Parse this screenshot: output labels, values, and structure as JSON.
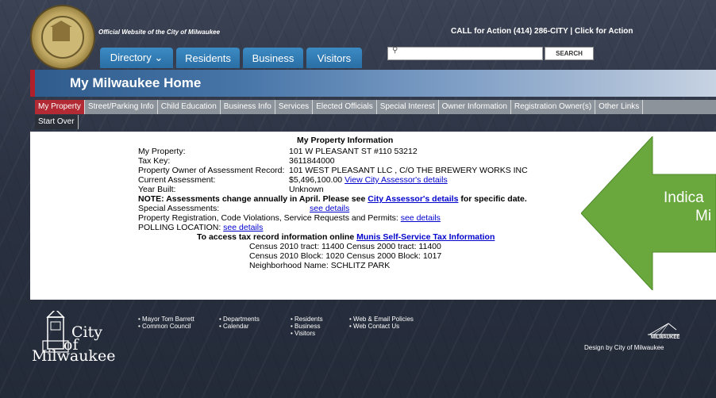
{
  "header": {
    "official_text": "Official Website of the City of Milwaukee",
    "call_action": "CALL for Action (414) 286-CITY | Click for Action",
    "nav_tabs": [
      "Directory ⌄",
      "Residents",
      "Business",
      "Visitors"
    ],
    "search_button": "SEARCH",
    "search_placeholder": ""
  },
  "page_title": "My Milwaukee Home",
  "subnav": [
    "My Property",
    "Street/Parking Info",
    "Child Education",
    "Business Info",
    "Services",
    "Elected Officials",
    "Special Interest",
    "Owner Information",
    "Registration Owner(s)",
    "Other Links"
  ],
  "start_over": "Start Over",
  "property": {
    "heading": "My Property Information",
    "my_property_label": "My Property:",
    "my_property_value": "101 W PLEASANT ST #110 53212",
    "tax_key_label": "Tax Key:",
    "tax_key_value": "3611844000",
    "owner_label": "Property Owner of Assessment Record:",
    "owner_value": "101 WEST PLEASANT LLC , C/O THE BREWERY WORKS INC",
    "assessment_label": "Current Assessment:",
    "assessment_value": "$5,496,100.00",
    "assessor_link": "View City Assessor's details",
    "year_built_label": "Year Built:",
    "year_built_value": "Unknown",
    "note_prefix": "NOTE: Assessments change annually in April. Please see",
    "note_link": "City Assessor's details",
    "note_suffix": "for specific date.",
    "special_label": "Special Assessments:",
    "special_link": "see details",
    "registration_text": "Property Registration, Code Violations, Service Requests and Permits:",
    "registration_link": "see details",
    "polling_label": "POLLING LOCATION:",
    "polling_link": "see details",
    "tax_access_text": "To access tax record information online",
    "tax_access_link": "Munis Self-Service Tax Information",
    "census_tract": "Census 2010 tract:   11400 Census 2000 tract:  11400",
    "census_block": "Census 2010 Block:  1020  Census 2000 Block: 1017",
    "neighborhood": "Neighborhood Name: SCHLITZ PARK"
  },
  "overlay": {
    "line1": "Indica",
    "line2": "Mi",
    "color": "#6aa83e"
  },
  "footer": {
    "city_line1": "City",
    "city_line2": "of",
    "city_line3": "Milwaukee",
    "col1": [
      "Mayor Tom Barrett",
      "Common Council"
    ],
    "col2": [
      "Departments",
      "Calendar"
    ],
    "col3": [
      "Residents",
      "Business",
      "Visitors"
    ],
    "col4": [
      "Web & Email Policies",
      "Web Contact Us"
    ],
    "mke_logo_text": "MILWAUKEE",
    "credit": "Design by City of Milwaukee"
  }
}
